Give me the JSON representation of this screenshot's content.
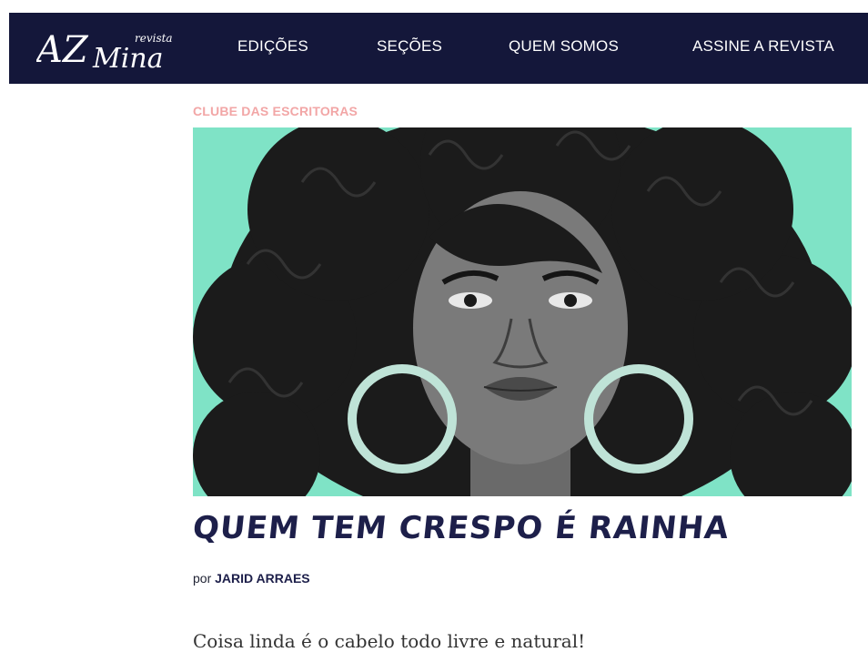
{
  "brand": {
    "logo_text_main": "AZ",
    "logo_text_sub": "Mina",
    "logo_text_tag": "revista"
  },
  "nav": {
    "items": [
      {
        "label": "EDIÇÕES"
      },
      {
        "label": "SEÇÕES"
      },
      {
        "label": "QUEM SOMOS"
      },
      {
        "label": "ASSINE A REVISTA"
      }
    ]
  },
  "article": {
    "section": "CLUBE DAS ESCRITORAS",
    "title": "QUEM TEM CRESPO É RAINHA",
    "by_prefix": "por",
    "author": "JARID ARRAES",
    "lead": "Coisa linda é o cabelo todo livre e natural!"
  },
  "colors": {
    "navbar_bg": "#14173a",
    "section_label": "#f2a6a6",
    "title": "#1d1f4a",
    "hero_bg": "#7fe3c6"
  }
}
